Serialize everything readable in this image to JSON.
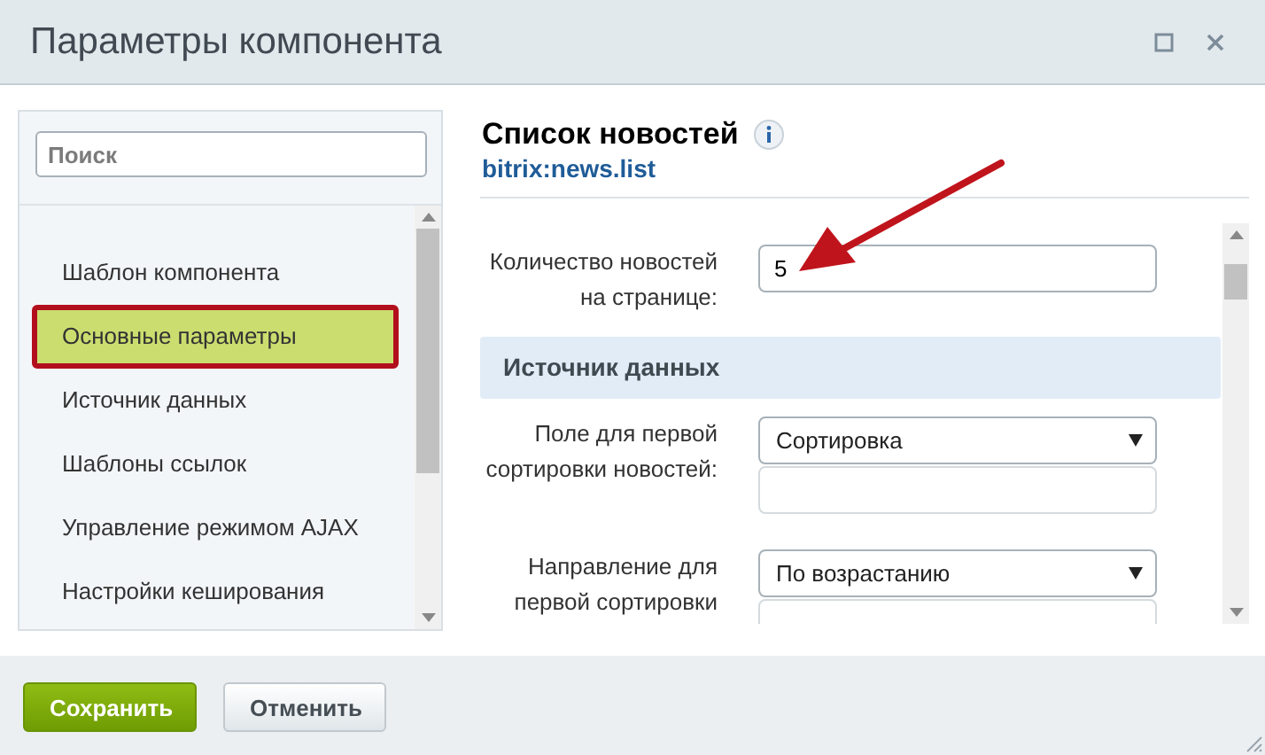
{
  "window": {
    "title": "Параметры компонента"
  },
  "sidebar": {
    "search": {
      "placeholder": "Поиск"
    },
    "items": [
      {
        "label": "Шаблон компонента",
        "selected": false
      },
      {
        "label": "Основные параметры",
        "selected": true
      },
      {
        "label": "Источник данных",
        "selected": false
      },
      {
        "label": "Шаблоны ссылок",
        "selected": false
      },
      {
        "label": "Управление режимом AJAX",
        "selected": false
      },
      {
        "label": "Настройки кеширования",
        "selected": false
      }
    ]
  },
  "component": {
    "title": "Список новостей",
    "code": "bitrix:news.list"
  },
  "form": [
    {
      "kind": "text_field",
      "label": "Количество новостей на странице:",
      "value": "5"
    },
    {
      "kind": "section",
      "label": "Источник данных"
    },
    {
      "kind": "select_field",
      "label": "Поле для первой сортировки новостей:",
      "value": "Сортировка"
    },
    {
      "kind": "select_field",
      "label": "Направление для первой сортировки",
      "value": "По возрастанию"
    }
  ],
  "buttons": [
    {
      "kind": "primary",
      "label": "Сохранить"
    },
    {
      "kind": "secondary",
      "label": "Отменить"
    }
  ]
}
